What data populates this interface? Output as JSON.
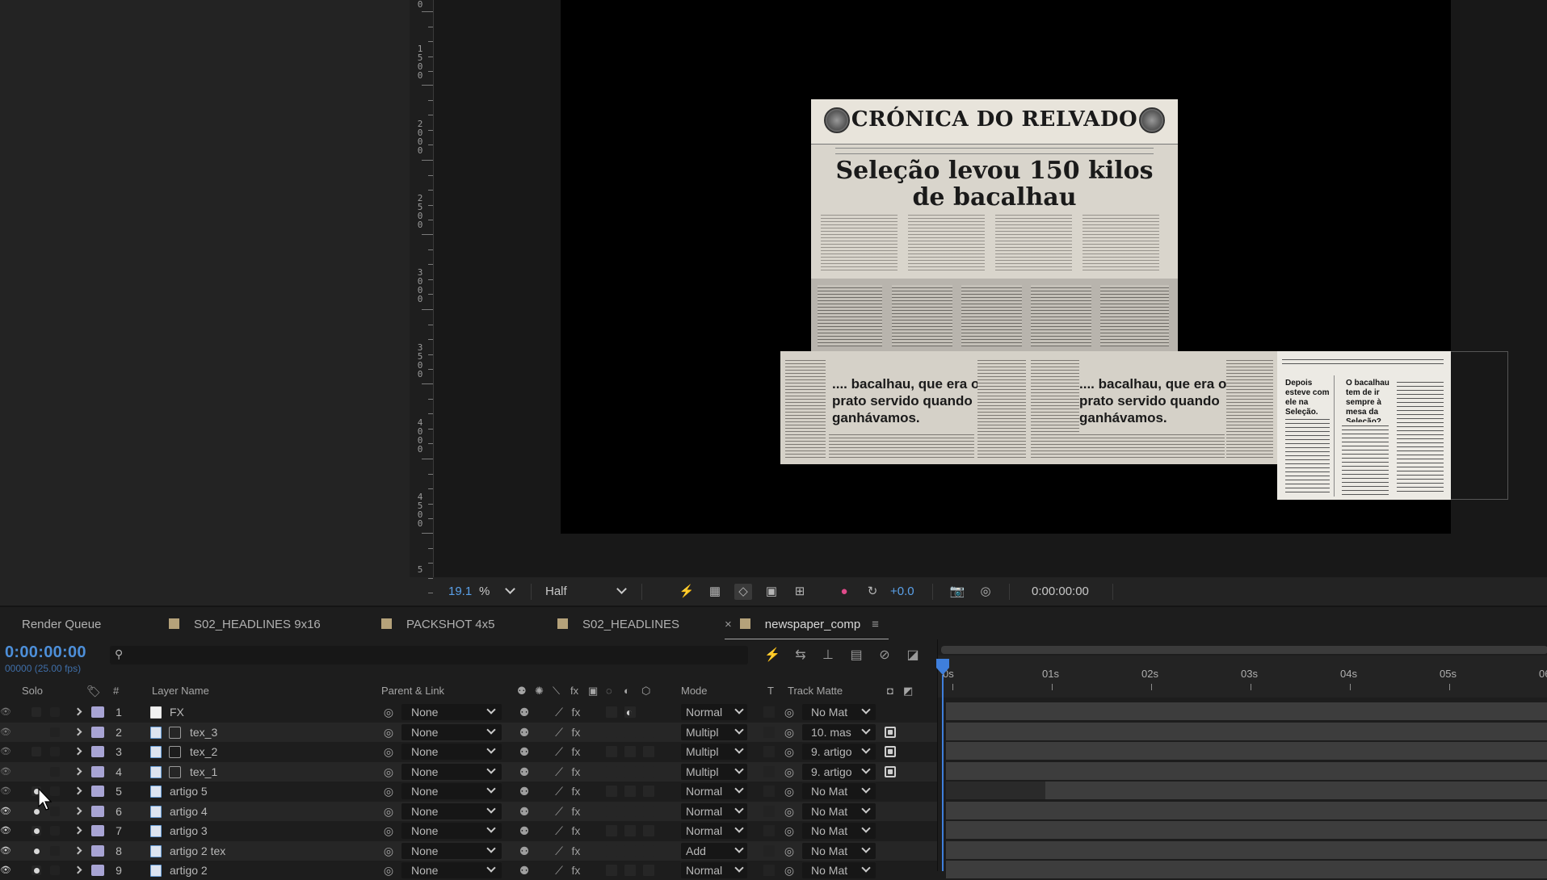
{
  "viewer": {
    "ruler_labels": [
      {
        "text": "0"
      },
      {
        "text": "1500"
      },
      {
        "text": "2000"
      },
      {
        "text": "2500"
      },
      {
        "text": "3000"
      },
      {
        "text": "3500"
      },
      {
        "text": "4000"
      },
      {
        "text": "4500"
      },
      {
        "text": "5"
      }
    ],
    "newspaper": {
      "masthead": "CRÓNICA DO RELVADO",
      "headline_line1": "Seleção levou 150 kilos",
      "headline_line2": "de bacalhau",
      "quote_text": ".... bacalhau, que era o prato servido quando ganhávamos.",
      "side_head1": "Depois esteve com ele na Seleção.",
      "side_head2": "O bacalhau tem de ir sempre à mesa da Seleção?"
    }
  },
  "viewer_toolbar": {
    "zoom_value": "19.1",
    "zoom_unit": "%",
    "resolution": "Half",
    "exposure": "+0.0",
    "timecode": "0:00:00:00"
  },
  "tabs": [
    {
      "label": "Render Queue",
      "color": null
    },
    {
      "label": "S02_HEADLINES 9x16",
      "color": "#b5a27a"
    },
    {
      "label": "PACKSHOT 4x5",
      "color": "#b5a27a"
    },
    {
      "label": "S02_HEADLINES",
      "color": "#b5a27a"
    },
    {
      "label": "newspaper_comp",
      "color": "#b5a27a",
      "active": true
    }
  ],
  "timeline": {
    "timecode": "0:00:00:00",
    "fps": "00000 (25.00 fps)",
    "search_placeholder": "",
    "headers": {
      "solo": "Solo",
      "num": "#",
      "layer_name": "Layer Name",
      "parent": "Parent & Link",
      "mode": "Mode",
      "t": "T",
      "track_matte": "Track Matte"
    },
    "time_ticks": [
      "0s",
      "01s",
      "02s",
      "03s",
      "04s",
      "05s",
      "06"
    ],
    "layers": [
      {
        "num": "1",
        "name": "FX",
        "type": "solid",
        "parent": "None",
        "mode": "Normal",
        "matte": "No Mat",
        "eye": false,
        "solo": false,
        "matte_icon": false
      },
      {
        "num": "2",
        "name": "tex_3",
        "type": "footage",
        "parent": "None",
        "mode": "Multipl",
        "matte": "10. mas",
        "eye": false,
        "solo": false,
        "matte_icon": true
      },
      {
        "num": "3",
        "name": "tex_2",
        "type": "footage",
        "parent": "None",
        "mode": "Multipl",
        "matte": "9. artigo",
        "eye": false,
        "solo": false,
        "matte_icon": true
      },
      {
        "num": "4",
        "name": "tex_1",
        "type": "footage",
        "parent": "None",
        "mode": "Multipl",
        "matte": "9. artigo",
        "eye": false,
        "solo": false,
        "matte_icon": true
      },
      {
        "num": "5",
        "name": "artigo 5",
        "type": "image",
        "parent": "None",
        "mode": "Normal",
        "matte": "No Mat",
        "eye": false,
        "solo": true,
        "matte_icon": false
      },
      {
        "num": "6",
        "name": "artigo 4",
        "type": "image",
        "parent": "None",
        "mode": "Normal",
        "matte": "No Mat",
        "eye": true,
        "solo": true,
        "matte_icon": false
      },
      {
        "num": "7",
        "name": "artigo 3",
        "type": "image",
        "parent": "None",
        "mode": "Normal",
        "matte": "No Mat",
        "eye": true,
        "solo": true,
        "matte_icon": false
      },
      {
        "num": "8",
        "name": "artigo 2 tex",
        "type": "image",
        "parent": "None",
        "mode": "Add",
        "matte": "No Mat",
        "eye": true,
        "solo": true,
        "matte_icon": false
      },
      {
        "num": "9",
        "name": "artigo 2",
        "type": "image",
        "parent": "None",
        "mode": "Normal",
        "matte": "No Mat",
        "eye": true,
        "solo": true,
        "matte_icon": false
      }
    ]
  },
  "colors": {
    "accent_blue": "#4d8fd9",
    "label_purple": "#a8a4d4",
    "tab_swatch": "#b5a27a"
  }
}
